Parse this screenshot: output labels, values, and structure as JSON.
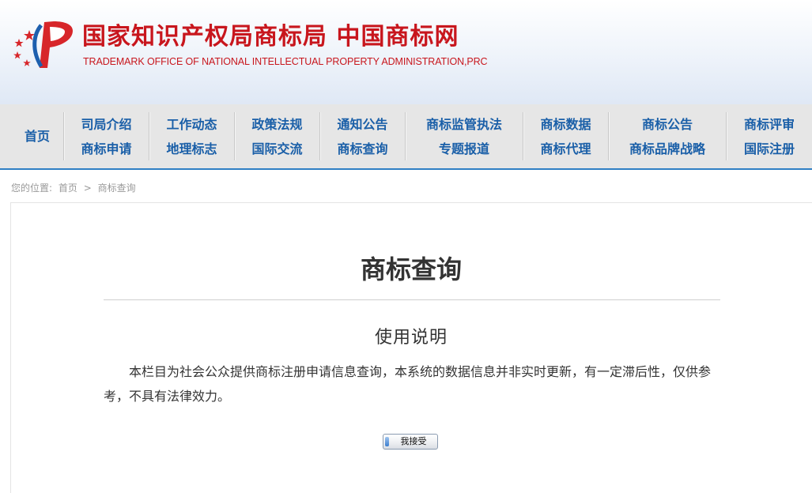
{
  "header": {
    "title_cn": "国家知识产权局商标局 中国商标网",
    "title_en": "TRADEMARK OFFICE OF NATIONAL INTELLECTUAL PROPERTY ADMINISTRATION,PRC",
    "logo_icon": "cnipa-emblem-icon",
    "brand_color": "#c8161d"
  },
  "nav": {
    "home": "首页",
    "columns": [
      {
        "top": "司局介绍",
        "bottom": "商标申请"
      },
      {
        "top": "工作动态",
        "bottom": "地理标志"
      },
      {
        "top": "政策法规",
        "bottom": "国际交流"
      },
      {
        "top": "通知公告",
        "bottom": "商标查询"
      },
      {
        "top": "商标监管执法",
        "bottom": "专题报道"
      },
      {
        "top": "商标数据",
        "bottom": "商标代理"
      },
      {
        "top": "商标公告",
        "bottom": "商标品牌战略"
      },
      {
        "top": "商标评审",
        "bottom": "国际注册"
      }
    ],
    "link_color": "#1a5fa8",
    "accent_color": "#2f7fc4"
  },
  "breadcrumb": {
    "prefix": "您的位置:",
    "home": "首页",
    "separator": ">",
    "current": "商标查询"
  },
  "main": {
    "page_title": "商标查询",
    "section_title": "使用说明",
    "notice": "本栏目为社会公众提供商标注册申请信息查询，本系统的数据信息并非实时更新，有一定滞后性，仅供参考，不具有法律效力。",
    "accept_label": "我接受"
  }
}
